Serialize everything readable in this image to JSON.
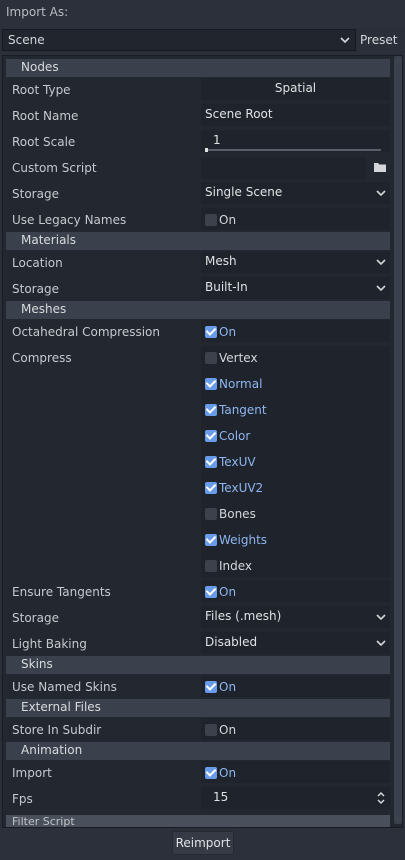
{
  "header": {
    "import_as_label": "Import As:"
  },
  "preset_row": {
    "selected": "Scene",
    "preset_label": "Preset"
  },
  "sections": {
    "nodes": "Nodes",
    "materials": "Materials",
    "meshes": "Meshes",
    "skins": "Skins",
    "external_files": "External Files",
    "animation": "Animation",
    "filter_script": "Filter Script"
  },
  "nodes": {
    "root_type_label": "Root Type",
    "root_type_value": "Spatial",
    "root_name_label": "Root Name",
    "root_name_value": "Scene Root",
    "root_scale_label": "Root Scale",
    "root_scale_value": "1",
    "custom_script_label": "Custom Script",
    "storage_label": "Storage",
    "storage_value": "Single Scene",
    "legacy_names_label": "Use Legacy Names",
    "legacy_names_value": "On"
  },
  "materials": {
    "location_label": "Location",
    "location_value": "Mesh",
    "storage_label": "Storage",
    "storage_value": "Built-In"
  },
  "meshes": {
    "octahedral_label": "Octahedral Compression",
    "octahedral_value": "On",
    "compress_label": "Compress",
    "compress_items": [
      {
        "label": "Vertex",
        "checked": false
      },
      {
        "label": "Normal",
        "checked": true
      },
      {
        "label": "Tangent",
        "checked": true
      },
      {
        "label": "Color",
        "checked": true
      },
      {
        "label": "TexUV",
        "checked": true
      },
      {
        "label": "TexUV2",
        "checked": true
      },
      {
        "label": "Bones",
        "checked": false
      },
      {
        "label": "Weights",
        "checked": true
      },
      {
        "label": "Index",
        "checked": false
      }
    ],
    "ensure_tangents_label": "Ensure Tangents",
    "ensure_tangents_value": "On",
    "storage_label": "Storage",
    "storage_value": "Files (.mesh)",
    "light_baking_label": "Light Baking",
    "light_baking_value": "Disabled"
  },
  "skins": {
    "named_skins_label": "Use Named Skins",
    "named_skins_value": "On"
  },
  "external_files": {
    "store_subdir_label": "Store In Subdir",
    "store_subdir_value": "On"
  },
  "animation": {
    "import_label": "Import",
    "import_value": "On",
    "fps_label": "Fps",
    "fps_value": "15"
  },
  "footer": {
    "reimport_label": "Reimport"
  },
  "colors": {
    "accent": "#699ce8",
    "on_text": "#8eb6f0",
    "panel_bg": "#232730",
    "section_bg": "#3b414c"
  }
}
